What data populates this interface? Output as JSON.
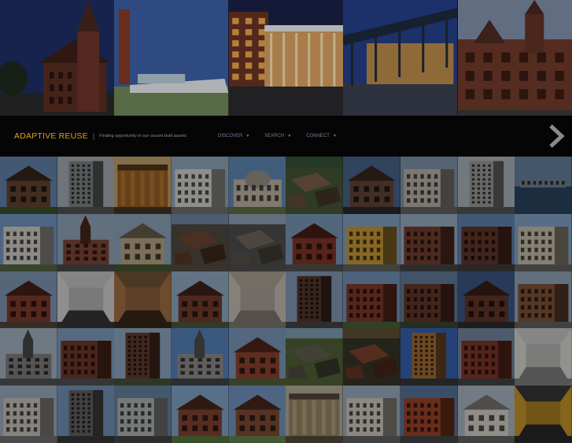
{
  "brand": {
    "title": "ADAPTIVE REUSE",
    "separator": "|",
    "tagline": "Finding opportunity in our vacant built assets"
  },
  "nav": {
    "items": [
      {
        "label": "DISCOVER",
        "icon": "caret-down-icon"
      },
      {
        "label": "SEARCH",
        "icon": "caret-down-icon"
      },
      {
        "label": "CONNECT",
        "icon": "caret-down-icon"
      }
    ],
    "next_icon": "chevron-right-icon"
  },
  "colors": {
    "brand": "#e0a21c",
    "nav_text": "#6f7f95",
    "bar": "#050505"
  },
  "hero": {
    "tiles": [
      {
        "subject": "church-spire",
        "sky": "#1d2e63"
      },
      {
        "subject": "brick-chimney-tower",
        "sky": "#3d5fa5"
      },
      {
        "subject": "lit-glass-atrium",
        "sky": "#1b2148"
      },
      {
        "subject": "steel-canopy-plaza",
        "sky": "#243e88"
      },
      {
        "subject": "gothic-brick-church",
        "sky": "#7d8ea6"
      }
    ]
  },
  "grid": {
    "columns": 10,
    "rows": 5,
    "thumbs": [
      {
        "sky": "#6d8fb8",
        "wall": "#6b4a35",
        "ground": "#3e5a2e",
        "kind": "house"
      },
      {
        "sky": "#b4bcc6",
        "wall": "#8c8e90",
        "ground": "#5a5a5a",
        "kind": "tower"
      },
      {
        "sky": "#d2b27a",
        "wall": "#a46a2b",
        "ground": "#4a3a28",
        "kind": "columns"
      },
      {
        "sky": "#9fb6cf",
        "wall": "#e6e6e2",
        "ground": "#7a7a7a",
        "kind": "block"
      },
      {
        "sky": "#6a96c8",
        "wall": "#cfc6b4",
        "ground": "#6a7a4a",
        "kind": "dome"
      },
      {
        "sky": "#3e5b3e",
        "wall": "#8a6b52",
        "ground": "#4d5f3b",
        "kind": "aerial"
      },
      {
        "sky": "#4e6f98",
        "wall": "#6b4b3b",
        "ground": "#2c2c2c",
        "kind": "house"
      },
      {
        "sky": "#8aa0b8",
        "wall": "#c9c3b9",
        "ground": "#6a6a6a",
        "kind": "block"
      },
      {
        "sky": "#b9c3cc",
        "wall": "#a8a8a5",
        "ground": "#5c5c5c",
        "kind": "tower"
      },
      {
        "sky": "#6e8dab",
        "wall": "#7f8d9a",
        "ground": "#2e4a66",
        "kind": "water"
      },
      {
        "sky": "#7ea4d3",
        "wall": "#e2e0d8",
        "ground": "#5d6d4a",
        "kind": "block"
      },
      {
        "sky": "#9fb3c8",
        "wall": "#8a4b3a",
        "ground": "#505050",
        "kind": "spire"
      },
      {
        "sky": "#9bb3cc",
        "wall": "#c8b591",
        "ground": "#4b5d34",
        "kind": "house"
      },
      {
        "sky": "#7c96b5",
        "wall": "#7a4c36",
        "ground": "#5a5148",
        "kind": "aerial"
      },
      {
        "sky": "#9eb2c7",
        "wall": "#7d7267",
        "ground": "#565656",
        "kind": "aerial"
      },
      {
        "sky": "#86a6c9",
        "wall": "#8d3b2a",
        "ground": "#5a5a5a",
        "kind": "house"
      },
      {
        "sky": "#8fb0d6",
        "wall": "#d8a63a",
        "ground": "#6a6a6a",
        "kind": "block"
      },
      {
        "sky": "#a6bcd3",
        "wall": "#7d4532",
        "ground": "#4a4a4a",
        "kind": "block"
      },
      {
        "sky": "#6a8fbf",
        "wall": "#6b3a2c",
        "ground": "#3f3f3f",
        "kind": "block"
      },
      {
        "sky": "#8fb0d8",
        "wall": "#d9cfb9",
        "ground": "#6a6a6a",
        "kind": "block"
      },
      {
        "sky": "#8aa5c4",
        "wall": "#8a4030",
        "ground": "#5a4a3a",
        "kind": "house"
      },
      {
        "sky": "#d6d6d6",
        "wall": "#e6e6e6",
        "ground": "#3a3a3a",
        "kind": "interior"
      },
      {
        "sky": "#7a5a3a",
        "wall": "#b07a4a",
        "ground": "#3a2a1a",
        "kind": "interior"
      },
      {
        "sky": "#9fbad8",
        "wall": "#7c4230",
        "ground": "#4f5f3f",
        "kind": "house"
      },
      {
        "sky": "#b8b0a4",
        "wall": "#d7cfc2",
        "ground": "#8a8478",
        "kind": "interior"
      },
      {
        "sky": "#8fa9c6",
        "wall": "#5b3c30",
        "ground": "#4a4a4a",
        "kind": "tower"
      },
      {
        "sky": "#7da0c8",
        "wall": "#8a3e2c",
        "ground": "#4f6a3a",
        "kind": "block"
      },
      {
        "sky": "#6c86a6",
        "wall": "#6f3c2c",
        "ground": "#3f4a33",
        "kind": "block"
      },
      {
        "sky": "#3f5f8f",
        "wall": "#6a3a2a",
        "ground": "#2f2f2f",
        "kind": "house"
      },
      {
        "sky": "#9fb4c9",
        "wall": "#8c5a3c",
        "ground": "#6a6a6a",
        "kind": "block"
      },
      {
        "sky": "#b4c4d4",
        "wall": "#8a8a8a",
        "ground": "#5a5a5a",
        "kind": "spire"
      },
      {
        "sky": "#8aaad0",
        "wall": "#7a3c2c",
        "ground": "#585858",
        "kind": "block"
      },
      {
        "sky": "#9ab6d4",
        "wall": "#6b4030",
        "ground": "#4a5a3a",
        "kind": "tower"
      },
      {
        "sky": "#5f8fd0",
        "wall": "#9c9a98",
        "ground": "#4a4a4a",
        "kind": "spire"
      },
      {
        "sky": "#86a7cc",
        "wall": "#9a4a32",
        "ground": "#5a6a3a",
        "kind": "house"
      },
      {
        "sky": "#8fb0c8",
        "wall": "#6a6a5a",
        "ground": "#5a6a3a",
        "kind": "aerial"
      },
      {
        "sky": "#6a5a3a",
        "wall": "#8a4a32",
        "ground": "#3a3a2a",
        "kind": "aerial"
      },
      {
        "sky": "#3d6bc2",
        "wall": "#b0763a",
        "ground": "#3a3a3a",
        "kind": "tower"
      },
      {
        "sky": "#7d94b0",
        "wall": "#8b3a2c",
        "ground": "#4a4a4a",
        "kind": "block"
      },
      {
        "sky": "#d8d8d8",
        "wall": "#eaeae6",
        "ground": "#8a8a8a",
        "kind": "interior"
      },
      {
        "sky": "#a8bcd0",
        "wall": "#d8d4cc",
        "ground": "#7a7a7a",
        "kind": "block"
      },
      {
        "sky": "#7da1c9",
        "wall": "#6a6a6a",
        "ground": "#3a3a3a",
        "kind": "tower"
      },
      {
        "sky": "#6f8faf",
        "wall": "#bfc2c4",
        "ground": "#4a4a4a",
        "kind": "block"
      },
      {
        "sky": "#8fb3dc",
        "wall": "#8e4a36",
        "ground": "#5f7f3f",
        "kind": "house"
      },
      {
        "sky": "#7da3d3",
        "wall": "#8c5238",
        "ground": "#6f8f4f",
        "kind": "house"
      },
      {
        "sky": "#c9bfa9",
        "wall": "#a3926f",
        "ground": "#5a5440",
        "kind": "columns"
      },
      {
        "sky": "#a7bdd4",
        "wall": "#e2dcd0",
        "ground": "#6a6a6a",
        "kind": "block"
      },
      {
        "sky": "#5f7fa8",
        "wall": "#a94a2c",
        "ground": "#4a4a4a",
        "kind": "block"
      },
      {
        "sky": "#b8c6d4",
        "wall": "#e8e4da",
        "ground": "#6a6a6a",
        "kind": "house"
      },
      {
        "sky": "#3d3d3d",
        "wall": "#d7a22c",
        "ground": "#2a2a2a",
        "kind": "interior"
      }
    ]
  }
}
